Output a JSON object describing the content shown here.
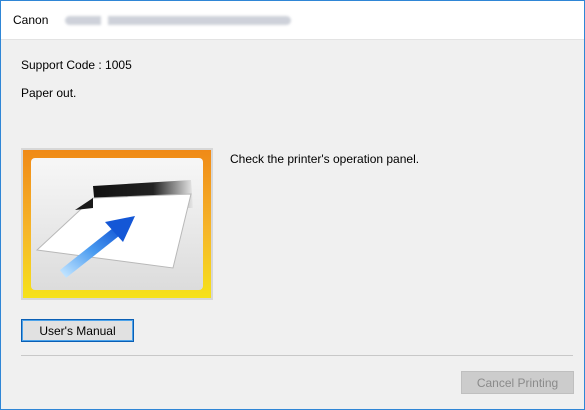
{
  "window": {
    "title": "Canon",
    "title_redacted": true
  },
  "main": {
    "support_code": "Support Code : 1005",
    "message": "Paper out.",
    "instruction": "Check the printer's operation panel.",
    "illustration_icon": "paper-feed-illustration-icon"
  },
  "buttons": {
    "manual_label": "User's Manual",
    "cancel_label": "Cancel Printing",
    "cancel_enabled": false
  },
  "colors": {
    "window_border": "#2f86d6",
    "background": "#f0f0f0",
    "button_focus": "#0a5fb5",
    "illustration_frame_top": "#f08a17",
    "illustration_frame_bottom": "#f6e21a",
    "arrow": "#1f6fe0"
  }
}
